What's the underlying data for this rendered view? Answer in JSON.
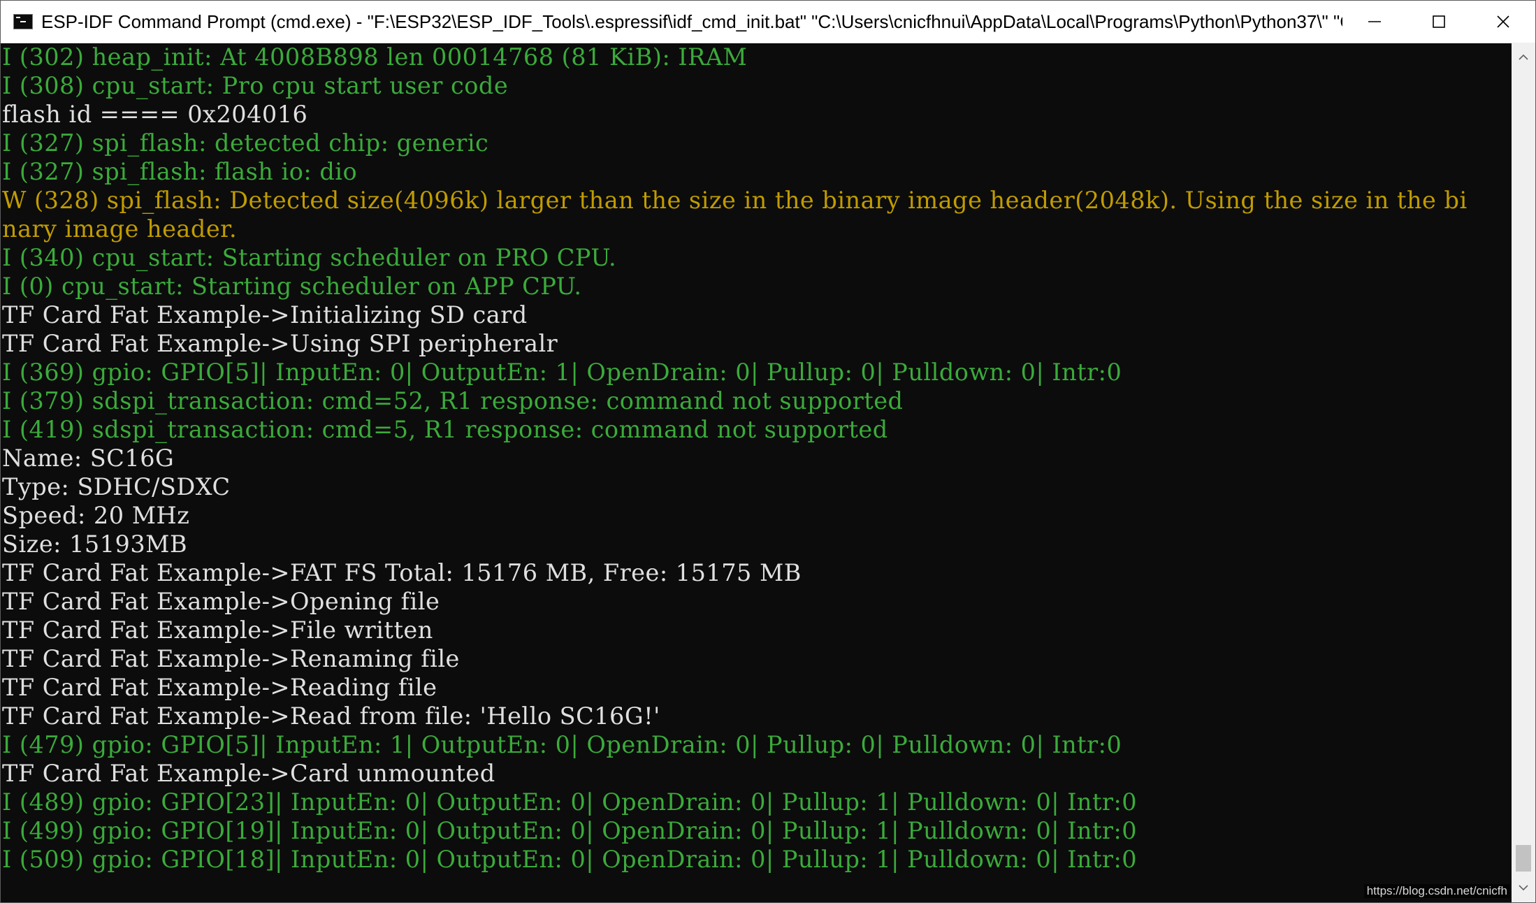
{
  "window": {
    "title": "ESP-IDF Command Prompt (cmd.exe) - \"F:\\ESP32\\ESP_IDF_Tools\\.espressif\\idf_cmd_init.bat\"  \"C:\\Users\\cnicfhnui\\AppData\\Local\\Programs\\Python\\Python37\\\" \"C...",
    "controls": {
      "minimize": "minimize-icon",
      "maximize": "maximize-icon",
      "close": "close-icon"
    }
  },
  "colors": {
    "green": "#3bab3b",
    "white": "#e0e0e0",
    "yellow": "#c19c00",
    "background": "#0c0c0c"
  },
  "console": {
    "lines": [
      {
        "color": "green",
        "text": "I (302) heap_init: At 4008B898 len 00014768 (81 KiB): IRAM"
      },
      {
        "color": "green",
        "text": "I (308) cpu_start: Pro cpu start user code"
      },
      {
        "color": "white",
        "text": "flash id ==== 0x204016"
      },
      {
        "color": "green",
        "text": "I (327) spi_flash: detected chip: generic"
      },
      {
        "color": "green",
        "text": "I (327) spi_flash: flash io: dio"
      },
      {
        "color": "yellow",
        "text": "W (328) spi_flash: Detected size(4096k) larger than the size in the binary image header(2048k). Using the size in the bi"
      },
      {
        "color": "yellow",
        "text": "nary image header."
      },
      {
        "color": "green",
        "text": "I (340) cpu_start: Starting scheduler on PRO CPU."
      },
      {
        "color": "green",
        "text": "I (0) cpu_start: Starting scheduler on APP CPU."
      },
      {
        "color": "white",
        "text": "TF Card Fat Example->Initializing SD card"
      },
      {
        "color": "white",
        "text": "TF Card Fat Example->Using SPI peripheralr"
      },
      {
        "color": "green",
        "text": "I (369) gpio: GPIO[5]| InputEn: 0| OutputEn: 1| OpenDrain: 0| Pullup: 0| Pulldown: 0| Intr:0"
      },
      {
        "color": "green",
        "text": "I (379) sdspi_transaction: cmd=52, R1 response: command not supported"
      },
      {
        "color": "green",
        "text": "I (419) sdspi_transaction: cmd=5, R1 response: command not supported"
      },
      {
        "color": "white",
        "text": "Name: SC16G"
      },
      {
        "color": "white",
        "text": "Type: SDHC/SDXC"
      },
      {
        "color": "white",
        "text": "Speed: 20 MHz"
      },
      {
        "color": "white",
        "text": "Size: 15193MB"
      },
      {
        "color": "white",
        "text": "TF Card Fat Example->FAT FS Total: 15176 MB, Free: 15175 MB"
      },
      {
        "color": "white",
        "text": "TF Card Fat Example->Opening file"
      },
      {
        "color": "white",
        "text": "TF Card Fat Example->File written"
      },
      {
        "color": "white",
        "text": "TF Card Fat Example->Renaming file"
      },
      {
        "color": "white",
        "text": "TF Card Fat Example->Reading file"
      },
      {
        "color": "white",
        "text": "TF Card Fat Example->Read from file: 'Hello SC16G!'"
      },
      {
        "color": "green",
        "text": "I (479) gpio: GPIO[5]| InputEn: 1| OutputEn: 0| OpenDrain: 0| Pullup: 0| Pulldown: 0| Intr:0"
      },
      {
        "color": "white",
        "text": "TF Card Fat Example->Card unmounted"
      },
      {
        "color": "green",
        "text": "I (489) gpio: GPIO[23]| InputEn: 0| OutputEn: 0| OpenDrain: 0| Pullup: 1| Pulldown: 0| Intr:0"
      },
      {
        "color": "green",
        "text": "I (499) gpio: GPIO[19]| InputEn: 0| OutputEn: 0| OpenDrain: 0| Pullup: 1| Pulldown: 0| Intr:0"
      },
      {
        "color": "green",
        "text": "I (509) gpio: GPIO[18]| InputEn: 0| OutputEn: 0| OpenDrain: 0| Pullup: 1| Pulldown: 0| Intr:0"
      }
    ]
  },
  "scrollbar": {
    "up": "chevron-up-icon",
    "down": "chevron-down-icon"
  },
  "watermark": "https://blog.csdn.net/cnicfh"
}
